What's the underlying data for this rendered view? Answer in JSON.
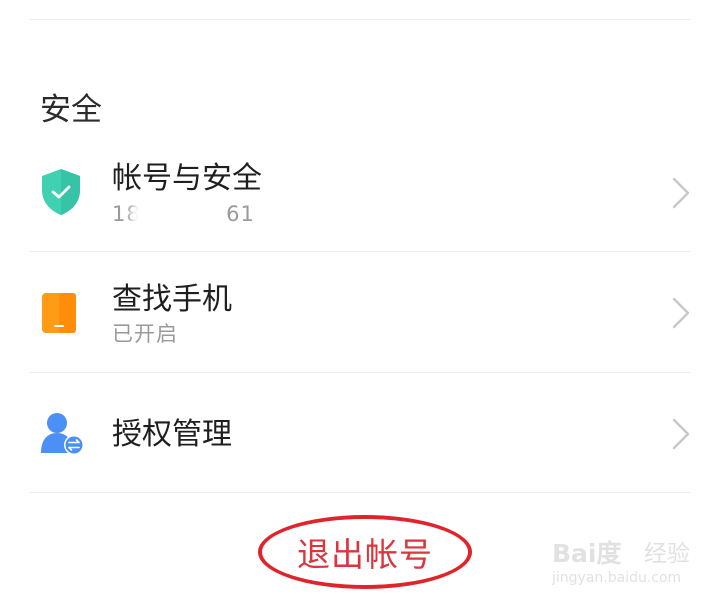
{
  "section": {
    "title": "安全"
  },
  "rows": [
    {
      "title": "帐号与安全",
      "subtitle_prefix": "18",
      "subtitle_suffix": "61",
      "icon": "shield-check-icon",
      "chevron": "chevron-right-icon"
    },
    {
      "title": "查找手机",
      "subtitle": "已开启",
      "icon": "phone-icon",
      "chevron": "chevron-right-icon"
    },
    {
      "title": "授权管理",
      "icon": "user-authorization-icon",
      "chevron": "chevron-right-icon"
    }
  ],
  "logout": {
    "label": "退出帐号"
  },
  "watermark": {
    "logo": "Bai度",
    "logo_suffix": "经验",
    "url": "jingyan.baidu.com"
  },
  "colors": {
    "shield": "#3fd1b2",
    "phone": "#ff9b15",
    "user": "#4c8ff5",
    "logout_red": "#d9363e",
    "divider": "#ececec",
    "chevron": "#c8c8c8"
  }
}
